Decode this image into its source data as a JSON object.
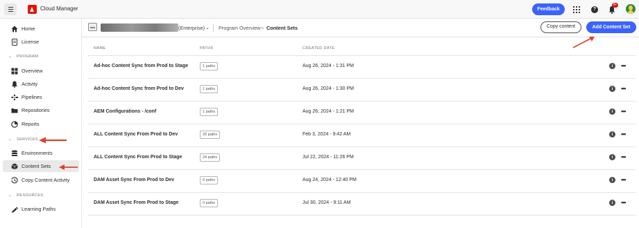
{
  "topbar": {
    "app_title": "Cloud Manager",
    "feedback_label": "Feedback",
    "notification_badge": "9+",
    "icons": [
      "hamburger-icon",
      "adobe-logo",
      "apps-grid-icon",
      "help-icon",
      "bell-icon",
      "avatar"
    ]
  },
  "sidebar": {
    "items": [
      {
        "label": "Home",
        "icon": "home-icon"
      },
      {
        "label": "License",
        "icon": "license-icon"
      },
      {
        "label": "Overview",
        "icon": "overview-icon"
      },
      {
        "label": "Activity",
        "icon": "bell-icon"
      },
      {
        "label": "Pipelines",
        "icon": "pipelines-icon"
      },
      {
        "label": "Repositories",
        "icon": "folder-icon"
      },
      {
        "label": "Reports",
        "icon": "reports-icon"
      },
      {
        "label": "Environments",
        "icon": "stack-icon"
      },
      {
        "label": "Content Sets",
        "icon": "cube-icon",
        "selected": true
      },
      {
        "label": "Copy Content Activity",
        "icon": "history-icon"
      },
      {
        "label": "Learning Paths",
        "icon": "learning-icon"
      }
    ],
    "sections": {
      "program": "PROGRAM",
      "services": "SERVICES",
      "resources": "RESOURCES"
    }
  },
  "header": {
    "program_suffix": "(Enterprise)",
    "crumb_parent": "Program Overview",
    "crumb_separator": ">",
    "crumb_current": "Content Sets",
    "copy_content_label": "Copy content",
    "add_content_set_label": "Add Content Set"
  },
  "table": {
    "columns": [
      "NAME",
      "PATHS",
      "CREATED DATE"
    ],
    "rows": [
      {
        "name": "Ad-hoc Content Sync from Prod to Stage",
        "paths": "1 paths",
        "created": "Aug 26, 2024 - 1:31 PM"
      },
      {
        "name": "Ad-hoc Content Sync from Prod to Dev",
        "paths": "1 paths",
        "created": "Aug 26, 2024 - 1:30 PM"
      },
      {
        "name": "AEM Configurations - /conf",
        "paths": "1 paths",
        "created": "Aug 26, 2024 - 1:21 PM"
      },
      {
        "name": "ALL Content Sync From Prod to Dev",
        "paths": "25 paths",
        "created": "Feb 3, 2024 - 9:42 AM"
      },
      {
        "name": "ALL Content Sync From Prod to Stage",
        "paths": "24 paths",
        "created": "Jul 22, 2024 - 11:26 PM"
      },
      {
        "name": "DAM Asset Sync From Prod to Dev",
        "paths": "0 paths",
        "created": "Aug 24, 2024 - 12:40 PM"
      },
      {
        "name": "DAM Asset Sync From Prod to Stage",
        "paths": "0 paths",
        "created": "Jul 30, 2024 - 9:11 AM"
      }
    ],
    "row_action_icons": [
      "info-icon",
      "more-icon"
    ]
  },
  "colors": {
    "accent_blue": "#3b63fb",
    "adobe_red": "#eb1000",
    "annotation_arrow": "#d9442c",
    "selected_nav_bg": "#e9e9e9"
  }
}
